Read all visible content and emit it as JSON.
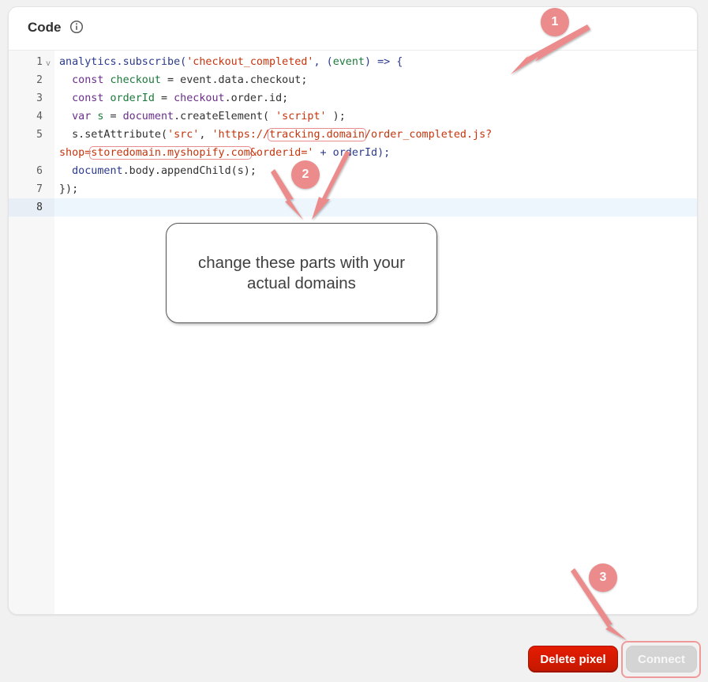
{
  "card": {
    "title": "Code",
    "info_icon": "info-circle-icon"
  },
  "editor": {
    "line_numbers": [
      "1",
      "2",
      "3",
      "4",
      "5",
      "6",
      "7",
      "8"
    ],
    "active_line": "8",
    "line1": {
      "a": "analytics.subscribe(",
      "b": "'checkout_completed'",
      "c": ", (",
      "d": "event",
      "e": ") => {"
    },
    "line2": {
      "a": "  const ",
      "b": "checkout",
      "c": " = event.data.checkout;"
    },
    "line3": {
      "a": "  const ",
      "b": "orderId",
      "c": " = ",
      "d": "checkout",
      "e": ".order.id;"
    },
    "line4": {
      "a": "  var ",
      "b": "s",
      "c": " = ",
      "d": "document",
      "e": ".createElement( ",
      "f": "'script'",
      "g": " );"
    },
    "line5": {
      "a": "  s.setAttribute(",
      "b": "'src'",
      "c": ", ",
      "d": "'https://",
      "e": "tracking.domain",
      "f": "/order_completed.js?"
    },
    "line5b": {
      "a": "shop=",
      "b": "storedomain.myshopify.com",
      "c": "&orderid='",
      "d": " + orderId);"
    },
    "line6": {
      "a": "  document",
      "b": ".body.appendChild(s);"
    },
    "line7": {
      "a": "});"
    }
  },
  "annotations": {
    "callout_text": "change these parts with your actual domains",
    "badge1": "1",
    "badge2": "2",
    "badge3": "3",
    "color": "#ec8b8b"
  },
  "footer": {
    "delete_label": "Delete pixel",
    "connect_label": "Connect",
    "delete_color": "#d91f00",
    "connect_color": "#d4d4d4"
  }
}
